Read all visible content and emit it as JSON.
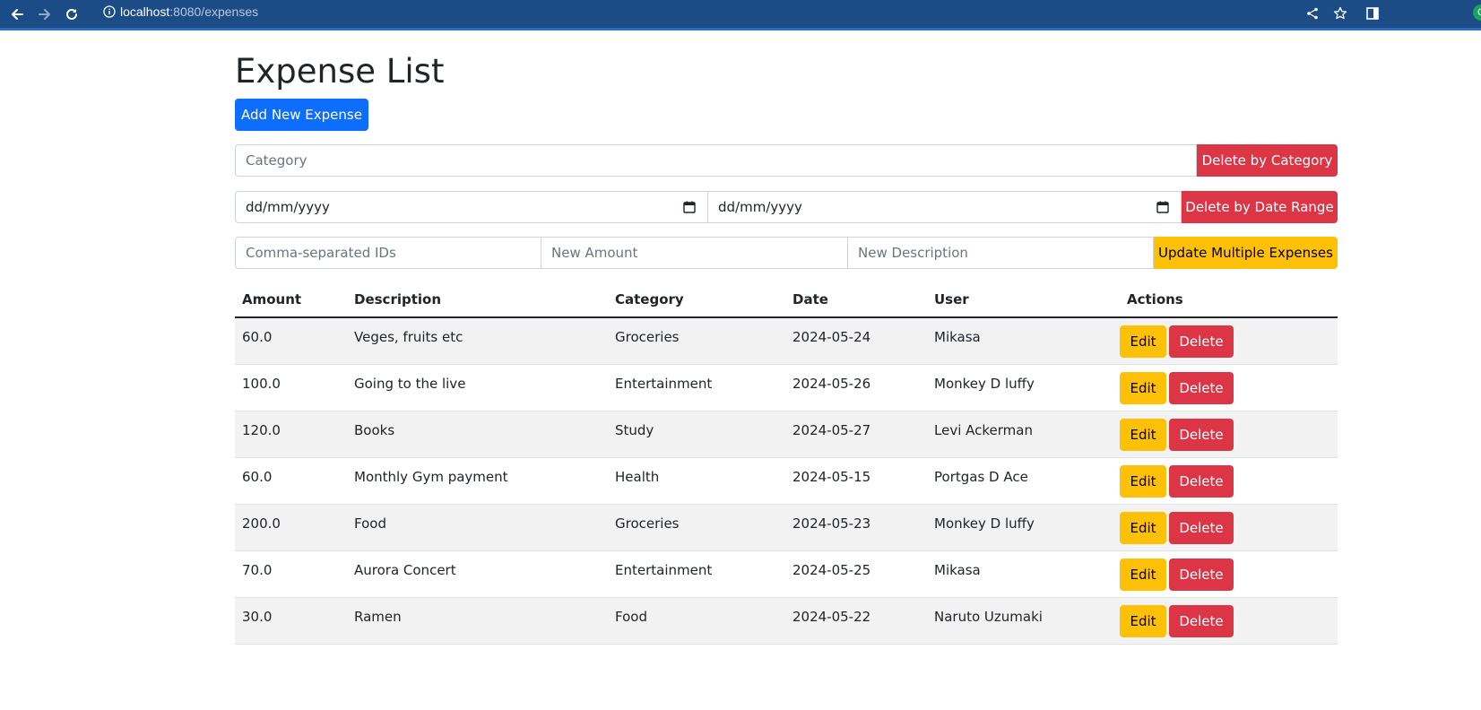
{
  "browser": {
    "url_host": "localhost",
    "url_path": ":8080/expenses",
    "profile_initial": "C"
  },
  "page": {
    "title": "Expense List",
    "add_button": "Add New Expense"
  },
  "filters": {
    "category_placeholder": "Category",
    "delete_by_category": "Delete by Category",
    "start_date_placeholder": "dd/mm/yyyy",
    "end_date_placeholder": "dd/mm/yyyy",
    "delete_by_date_range": "Delete by Date Range",
    "ids_placeholder": "Comma-separated IDs",
    "amount_placeholder": "New Amount",
    "description_placeholder": "New Description",
    "update_multiple": "Update Multiple Expenses"
  },
  "table": {
    "headers": {
      "amount": "Amount",
      "description": "Description",
      "category": "Category",
      "date": "Date",
      "user": "User",
      "actions": "Actions"
    },
    "edit_label": "Edit",
    "delete_label": "Delete",
    "rows": [
      {
        "amount": "60.0",
        "description": "Veges, fruits etc",
        "category": "Groceries",
        "date": "2024-05-24",
        "user": "Mikasa"
      },
      {
        "amount": "100.0",
        "description": "Going to the live",
        "category": "Entertainment",
        "date": "2024-05-26",
        "user": "Monkey D luffy"
      },
      {
        "amount": "120.0",
        "description": "Books",
        "category": "Study",
        "date": "2024-05-27",
        "user": "Levi Ackerman"
      },
      {
        "amount": "60.0",
        "description": "Monthly Gym payment",
        "category": "Health",
        "date": "2024-05-15",
        "user": "Portgas D Ace"
      },
      {
        "amount": "200.0",
        "description": "Food",
        "category": "Groceries",
        "date": "2024-05-23",
        "user": "Monkey D luffy"
      },
      {
        "amount": "70.0",
        "description": "Aurora Concert",
        "category": "Entertainment",
        "date": "2024-05-25",
        "user": "Mikasa"
      },
      {
        "amount": "30.0",
        "description": "Ramen",
        "category": "Food",
        "date": "2024-05-22",
        "user": "Naruto Uzumaki"
      }
    ]
  },
  "colors": {
    "chrome": "#1b4c86",
    "primary": "#0d6efd",
    "danger": "#dc3545",
    "warning": "#ffc107"
  }
}
